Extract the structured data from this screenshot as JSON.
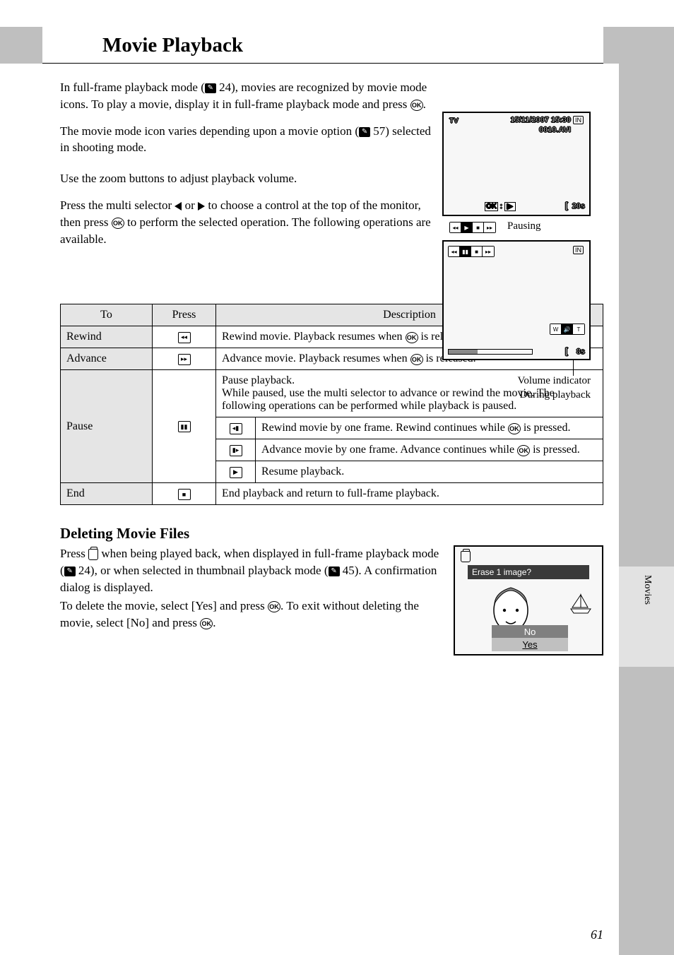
{
  "title": "Movie Playback",
  "paragraphs": {
    "p1a": "In full-frame playback mode (",
    "p1_ref": " 24), movies are recognized by movie mode icons. To play a movie, display it in full-frame playback mode and press ",
    "p1b": ".",
    "p2a": "The movie mode icon varies depending upon a movie option (",
    "p2_ref": " 57) selected in shooting mode.",
    "p3": "Use the zoom buttons to adjust playback volume.",
    "p4a": "Press the multi selector ",
    "p4b": " or ",
    "p4c": " to choose a control at the top of the monitor, then press ",
    "p4d": " to perform the selected operation. The following operations are available."
  },
  "lcd_top": {
    "mode": "TV",
    "date": "15/11/2007 15:30",
    "file": "0010.AVI",
    "hint": "OK : ▶",
    "time": "20s"
  },
  "pausing_label": "Pausing",
  "lcd_bot": {
    "time": "8s"
  },
  "captions": {
    "vol": "Volume indicator",
    "during": "During playback"
  },
  "table": {
    "headers": {
      "to": "To",
      "press": "Press",
      "desc": "Description"
    },
    "rewind": {
      "to": "Rewind",
      "desc_a": "Rewind movie. Playback resumes when ",
      "desc_b": " is released."
    },
    "advance": {
      "to": "Advance",
      "desc_a": "Advance movie. Playback resumes when ",
      "desc_b": " is released."
    },
    "pause": {
      "to": "Pause",
      "intro": "Pause playback.\nWhile paused, use the multi selector to advance or rewind the movie. The following operations can be performed while playback is paused.",
      "r1a": "Rewind movie by one frame. Rewind continues while ",
      "r1b": " is pressed.",
      "r2a": "Advance movie by one frame. Advance continues while ",
      "r2b": " is pressed.",
      "r3": "Resume playback."
    },
    "end": {
      "to": "End",
      "desc": "End playback and return to full-frame playback."
    }
  },
  "delete": {
    "heading": "Deleting Movie Files",
    "p1a": "Press ",
    "p1b": " when being played back, when displayed in full-frame playback mode (",
    "p1c": " 24), or when selected in thumbnail playback mode (",
    "p1d": " 45). A confirmation dialog is displayed.",
    "p2a": "To delete the movie, select [Yes] and press ",
    "p2b": ". To exit without deleting the movie, select [No] and press ",
    "p2c": "."
  },
  "dialog": {
    "title": "Erase 1 image?",
    "no": "No",
    "yes": "Yes"
  },
  "side_tab": "Movies",
  "page_num": "61"
}
